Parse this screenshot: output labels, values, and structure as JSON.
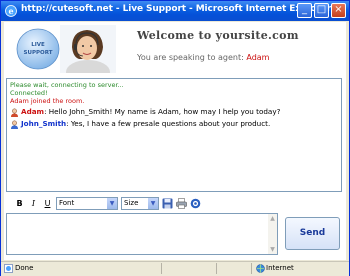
{
  "window": {
    "title": "http://cutesoft.net - Live Support - Microsoft Internet Explorer",
    "minimize": "_",
    "maximize": "□",
    "close": "×"
  },
  "header": {
    "logo_text_top": "LIVE",
    "logo_text_bottom": "SUPPORT",
    "welcome": "Welcome to yoursite.com",
    "agent_prefix": "You are speaking to agent:",
    "agent_name": "Adam"
  },
  "chat": {
    "system": [
      {
        "text": "Please wait, connecting to server...",
        "color": "#2a8a2a"
      },
      {
        "text": "Connected!",
        "color": "#2a8a2a"
      },
      {
        "text": "Adam joined the room.",
        "color": "#cc1111"
      }
    ],
    "messages": [
      {
        "sender": "Adam",
        "text": "Hello John_Smith! My name is Adam, how may I help you today?",
        "sender_color": "#cc1111"
      },
      {
        "sender": "John_Smith",
        "text": "Yes, I have a few presale questions about your product.",
        "sender_color": "#1133cc"
      }
    ]
  },
  "toolbar": {
    "bold": "B",
    "italic": "I",
    "underline": "U",
    "font_select": "Font",
    "size_select": "Size"
  },
  "composer": {
    "send_label": "Send",
    "up_arrow": "▲",
    "down_arrow": "▼"
  },
  "statusbar": {
    "status": "Done",
    "zone": "Internet"
  }
}
